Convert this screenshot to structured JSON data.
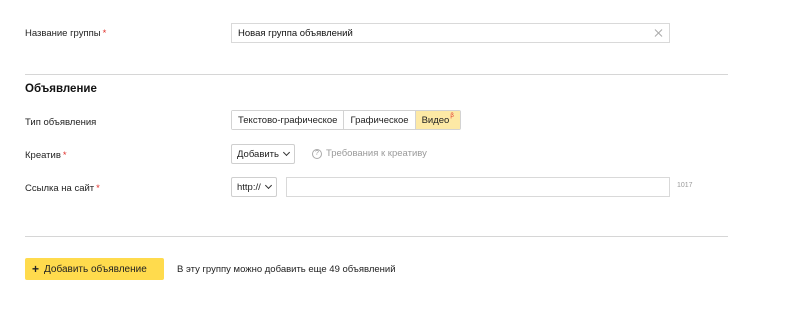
{
  "group": {
    "label": "Название группы",
    "required_mark": "*",
    "value": "Новая группа объявлений"
  },
  "ad": {
    "section_title": "Объявление",
    "type": {
      "label": "Тип объявления",
      "options": [
        "Текстово-графическое",
        "Графическое",
        "Видео"
      ],
      "beta_mark": "β",
      "selected": "Видео"
    },
    "creative": {
      "label": "Креатив",
      "required_mark": "*",
      "add_label": "Добавить",
      "help_text": "Требования к креативу"
    },
    "url": {
      "label": "Ссылка на сайт",
      "required_mark": "*",
      "protocol": "http://",
      "value": "",
      "counter": "1017"
    }
  },
  "footer": {
    "add_button": "Добавить объявление",
    "plus": "+",
    "hint": "В эту группу можно добавить еще 49 объявлений"
  }
}
